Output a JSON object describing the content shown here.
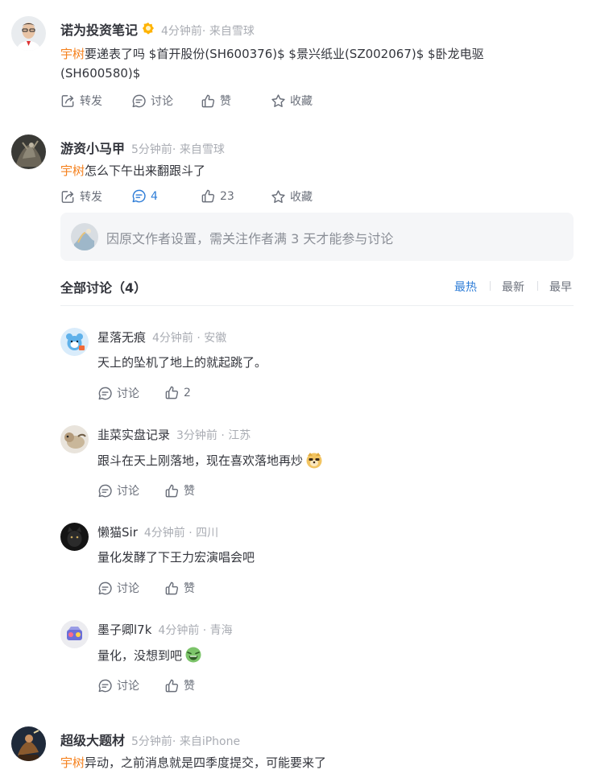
{
  "posts": [
    {
      "author": "诺为投资笔记",
      "meta": "4分钟前· 来自雪球",
      "mention": "宇树",
      "text": "要递表了吗 $首开股份(SH600376)$ $景兴纸业(SZ002067)$ $卧龙电驱(SH600580)$",
      "actions": {
        "forward": "转发",
        "discuss": "讨论",
        "like": "赞",
        "fav": "收藏"
      }
    },
    {
      "author": "游资小马甲",
      "meta": "5分钟前· 来自雪球",
      "mention": "宇树",
      "text": "怎么下午出来翻跟斗了",
      "actions": {
        "forward": "转发",
        "discuss": "4",
        "like": "23",
        "fav": "收藏"
      }
    },
    {
      "author": "超级大题材",
      "meta": "5分钟前· 来自iPhone",
      "mention": "宇树",
      "text": "异动，之前消息就是四季度提交，可能要来了"
    }
  ],
  "notice": "因原文作者设置，需关注作者满 3 天才能参与讨论",
  "discussion": {
    "title": "全部讨论（4）",
    "sort": [
      "最热",
      "最新",
      "最早"
    ],
    "replies": [
      {
        "name": "星落无痕",
        "meta": "4分钟前 · 安徽",
        "text": "天上的坠机了地上的就起跳了。",
        "discuss": "讨论",
        "like": "2"
      },
      {
        "name": "韭菜实盘记录",
        "meta": "3分钟前 · 江苏",
        "text": "跟斗在天上刚落地，现在喜欢落地再炒",
        "discuss": "讨论",
        "like": "赞"
      },
      {
        "name": "懒猫Sir",
        "meta": "4分钟前 · 四川",
        "text": "量化发酵了下王力宏演唱会吧",
        "discuss": "讨论",
        "like": "赞"
      },
      {
        "name": "墨子卿l7k",
        "meta": "4分钟前 · 青海",
        "text": "量化，没想到吧",
        "discuss": "讨论",
        "like": "赞"
      }
    ]
  },
  "icons": [
    "forward-icon",
    "comment-icon",
    "like-icon",
    "star-icon"
  ],
  "colors": {
    "mention": "#f5821f",
    "active": "#2e7dd7",
    "meta": "#a9acb3",
    "text": "#33353c"
  }
}
